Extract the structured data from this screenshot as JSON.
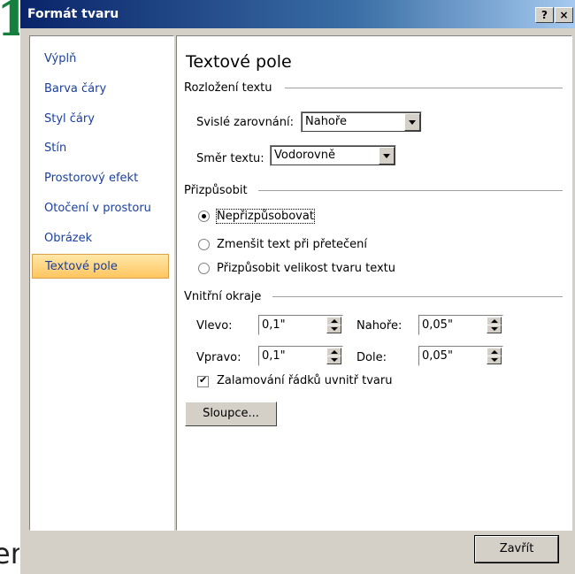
{
  "background": {
    "left_fragment": "1",
    "bottom_fragment": "en"
  },
  "dialog": {
    "title": "Formát tvaru",
    "help_button": "?",
    "close_button": "×"
  },
  "nav": {
    "items": [
      {
        "label": "Výplň"
      },
      {
        "label": "Barva čáry"
      },
      {
        "label": "Styl čáry"
      },
      {
        "label": "Stín"
      },
      {
        "label": "Prostorový efekt"
      },
      {
        "label": "Otočení v prostoru"
      },
      {
        "label": "Obrázek"
      },
      {
        "label": "Textové pole",
        "selected": true
      }
    ]
  },
  "panel": {
    "title": "Textové pole",
    "layout_section": {
      "title": "Rozložení textu",
      "vertical_align_label": "Svislé zarovnání:",
      "vertical_align_value": "Nahoře",
      "direction_label": "Směr textu:",
      "direction_value": "Vodorovně"
    },
    "autofit_section": {
      "title": "Přizpůsobit",
      "options": [
        {
          "label": "Nepřizpůsobovat",
          "selected": true
        },
        {
          "label": "Zmenšit text při přetečení",
          "selected": false
        },
        {
          "label": "Přizpůsobit velikost tvaru textu",
          "selected": false
        }
      ]
    },
    "margins_section": {
      "title": "Vnitřní okraje",
      "left_label": "Vlevo:",
      "left_value": "0,1\"",
      "right_label": "Vpravo:",
      "right_value": "0,1\"",
      "top_label": "Nahoře:",
      "top_value": "0,05\"",
      "bottom_label": "Dole:",
      "bottom_value": "0,05\""
    },
    "wrap_checkbox": {
      "label": "Zalamování řádků uvnitř tvaru",
      "checked": true
    },
    "columns_button": "Sloupce..."
  },
  "footer": {
    "close_button": "Zavřít"
  }
}
